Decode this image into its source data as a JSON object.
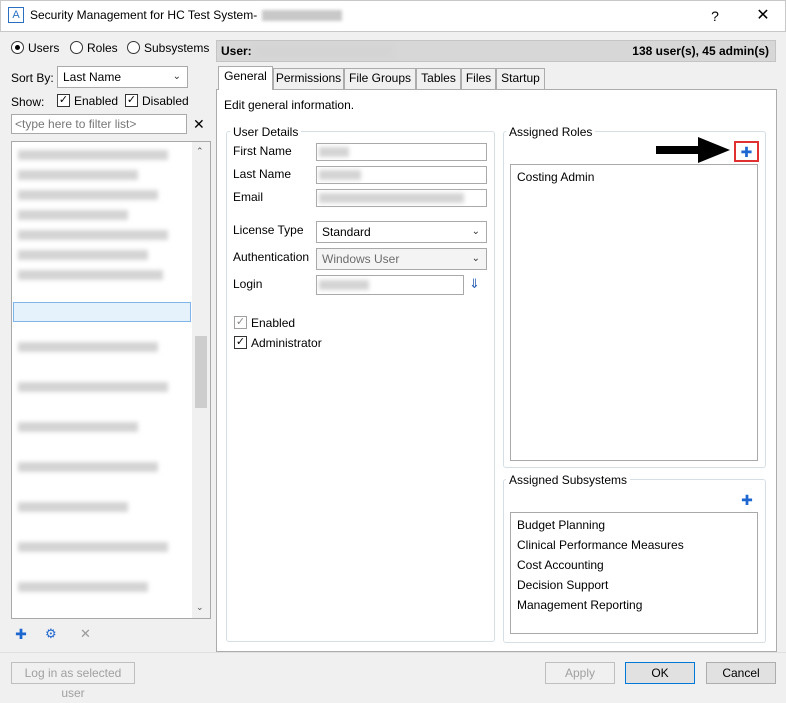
{
  "window": {
    "app_icon": "A",
    "title": "Security Management for HC Test System- ",
    "help": "?",
    "close": "✕"
  },
  "left": {
    "view_options": [
      "Users",
      "Roles",
      "Subsystems"
    ],
    "sort_by_label": "Sort By:",
    "sort_by_value": "Last Name",
    "show_label": "Show:",
    "show_enabled": "Enabled",
    "show_disabled": "Disabled",
    "filter_placeholder": "<type here to filter list>",
    "clear_filter": "✕",
    "login_as_selected": "Log in as selected user"
  },
  "header": {
    "user_label": "User:",
    "counts": "138 user(s), 45 admin(s)"
  },
  "tabs": [
    "General",
    "Permissions",
    "File Groups",
    "Tables",
    "Files",
    "Startup"
  ],
  "general": {
    "description": "Edit general information.",
    "user_details_title": "User Details",
    "first_name_label": "First Name",
    "last_name_label": "Last Name",
    "email_label": "Email",
    "license_type_label": "License Type",
    "license_type_value": "Standard",
    "authentication_label": "Authentication",
    "authentication_value": "Windows User",
    "login_label": "Login",
    "enabled_label": "Enabled",
    "administrator_label": "Administrator",
    "assigned_roles_title": "Assigned Roles",
    "assigned_roles": [
      "Costing Admin"
    ],
    "assigned_subsystems_title": "Assigned Subsystems",
    "assigned_subsystems": [
      "Budget Planning",
      "Clinical Performance Measures",
      "Cost Accounting",
      "Decision Support",
      "Management Reporting"
    ]
  },
  "footer": {
    "apply": "Apply",
    "ok": "OK",
    "cancel": "Cancel"
  },
  "colors": {
    "accent": "#0078d7",
    "highlight_box": "#e0302f",
    "plus_icon": "#1e66d0"
  }
}
